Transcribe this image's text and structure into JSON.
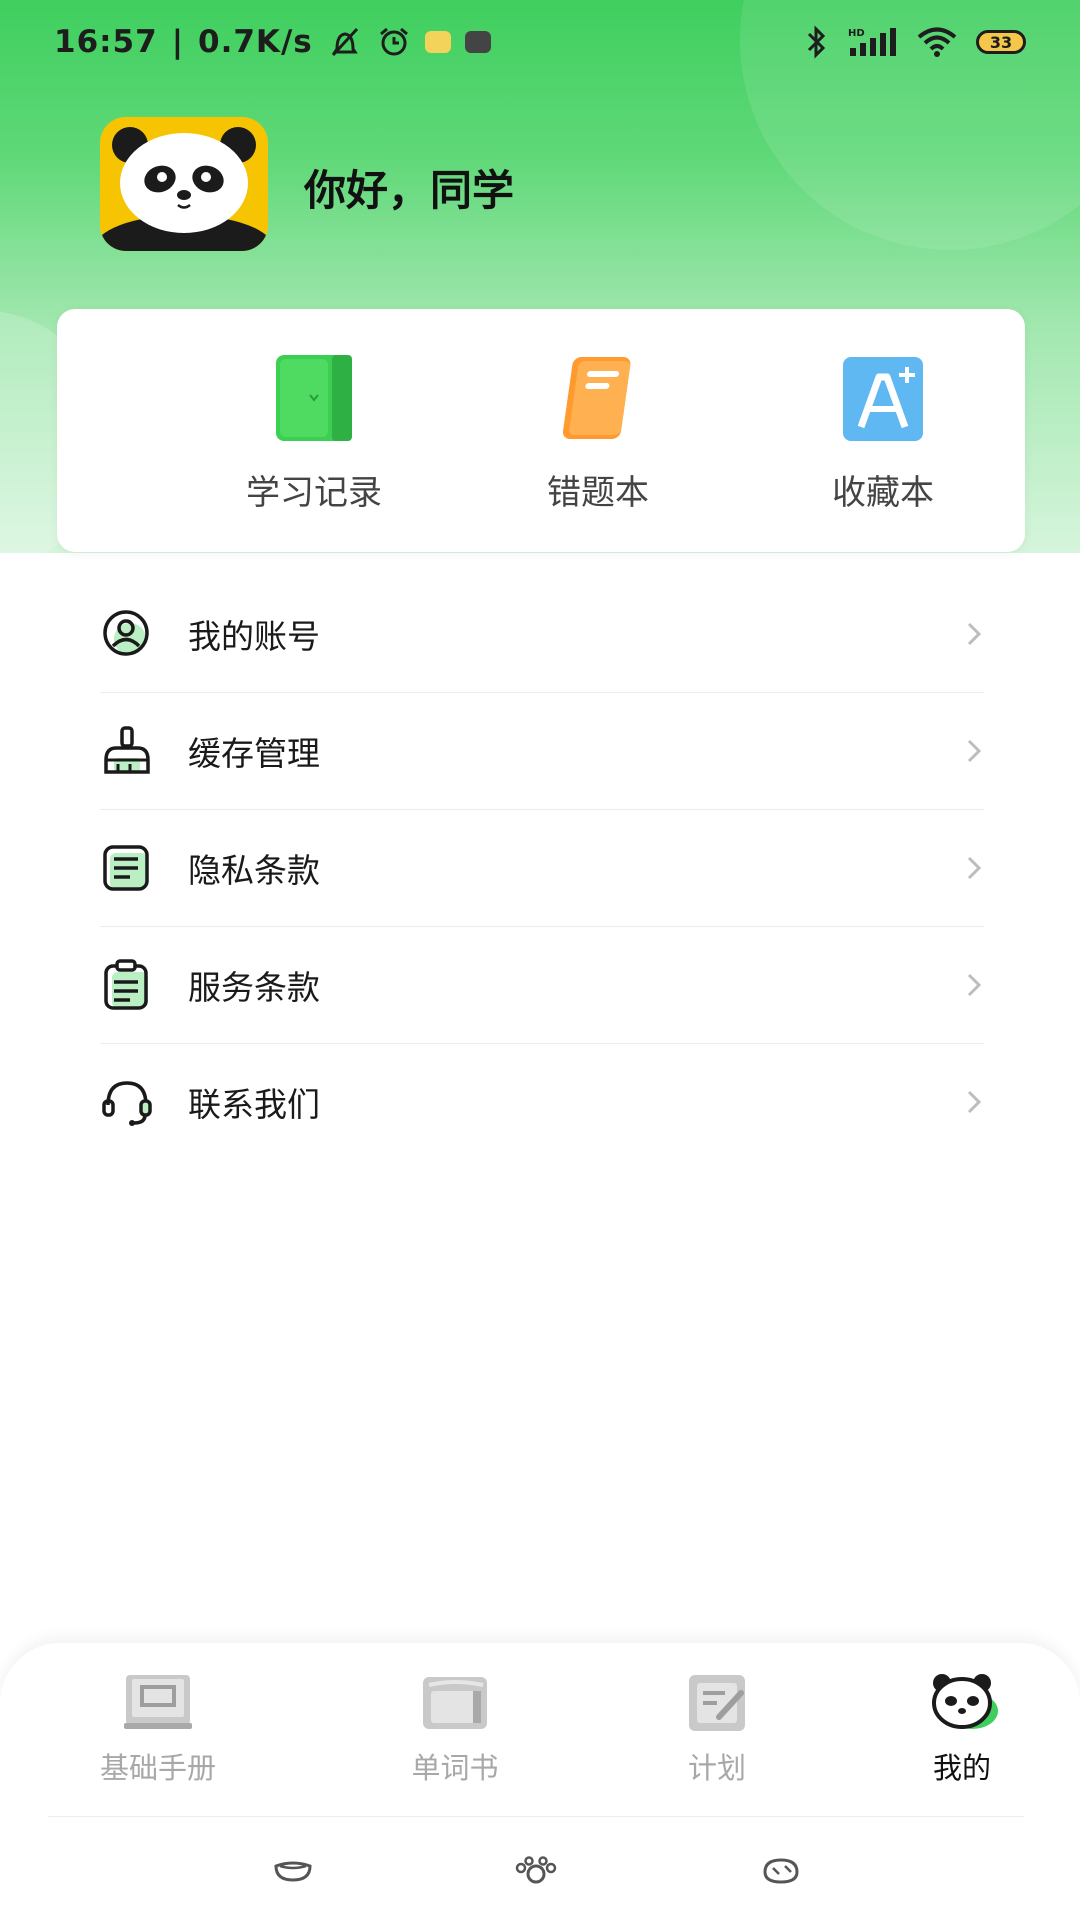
{
  "status_bar": {
    "time": "16:57",
    "network_speed": "0.7K/s",
    "battery": "33",
    "icons": [
      "mute-icon",
      "alarm-icon",
      "app-notification-icon",
      "app-notification-icon",
      "bluetooth-icon",
      "signal-hd-icon",
      "wifi-icon",
      "battery-icon"
    ]
  },
  "profile": {
    "greeting": "你好，同学",
    "avatar_icon": "panda-avatar"
  },
  "quick_actions": [
    {
      "label": "学习记录",
      "icon": "green-book-icon",
      "color": "#3ccf52"
    },
    {
      "label": "错题本",
      "icon": "orange-notebook-icon",
      "color": "#ff9a2e"
    },
    {
      "label": "收藏本",
      "icon": "blue-font-a-icon",
      "color": "#5fb8f2"
    }
  ],
  "menu": [
    {
      "label": "我的账号",
      "icon": "user-circle-icon"
    },
    {
      "label": "缓存管理",
      "icon": "brush-icon"
    },
    {
      "label": "隐私条款",
      "icon": "document-lines-icon"
    },
    {
      "label": "服务条款",
      "icon": "clipboard-icon"
    },
    {
      "label": "联系我们",
      "icon": "headset-icon"
    }
  ],
  "bottom_nav": {
    "tabs": [
      {
        "label": "基础手册",
        "icon": "handbook-icon",
        "active": false
      },
      {
        "label": "单词书",
        "icon": "wordbook-icon",
        "active": false
      },
      {
        "label": "计划",
        "icon": "plan-edit-icon",
        "active": false
      },
      {
        "label": "我的",
        "icon": "panda-tab-icon",
        "active": true
      }
    ],
    "system_keys": [
      "back-gesture-icon",
      "home-gesture-icon",
      "recent-gesture-icon"
    ]
  },
  "colors": {
    "brand_green": "#3fcf5e",
    "active_tab_text": "#111111",
    "inactive_tab_text": "#a8a8a8"
  }
}
